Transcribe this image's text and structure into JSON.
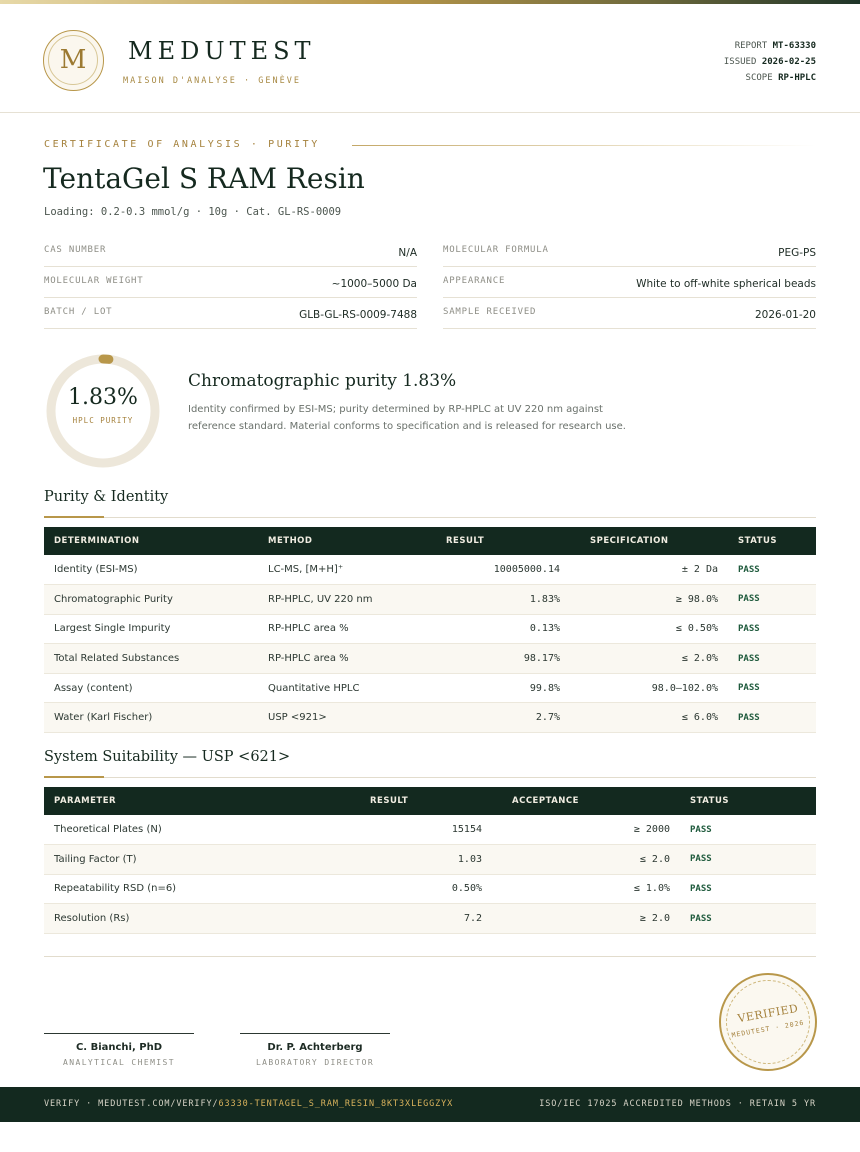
{
  "brand": {
    "logo_letter": "M",
    "name": "MEDUTEST",
    "tagline": "MAISON D'ANALYSE · GENÈVE"
  },
  "report_meta": [
    {
      "label": "REPORT",
      "value": "MT-63330"
    },
    {
      "label": "ISSUED",
      "value": "2026-02-25"
    },
    {
      "label": "SCOPE",
      "value": "RP-HPLC"
    }
  ],
  "document": {
    "eyebrow": "CERTIFICATE OF ANALYSIS · PURITY",
    "title": "TentaGel S RAM Resin",
    "subtitle": "Loading: 0.2-0.3 mmol/g · 10g  ·  Cat. GL-RS-0009"
  },
  "specs_left": [
    {
      "key": "CAS NUMBER",
      "value": "N/A"
    },
    {
      "key": "MOLECULAR WEIGHT",
      "value": "~1000–5000 Da"
    },
    {
      "key": "BATCH / LOT",
      "value": "GLB-GL-RS-0009-7488"
    }
  ],
  "specs_right": [
    {
      "key": "MOLECULAR FORMULA",
      "value": "PEG-PS"
    },
    {
      "key": "APPEARANCE",
      "value": "White to off-white spherical beads"
    },
    {
      "key": "SAMPLE RECEIVED",
      "value": "2026-01-20"
    }
  ],
  "purity": {
    "value_text": "1.83%",
    "value_fraction": 0.0183,
    "label": "HPLC PURITY",
    "heading": "Chromatographic purity 1.83%",
    "text": "Identity confirmed by ESI-MS; purity determined by RP-HPLC at UV 220 nm against reference standard. Material conforms to specification and is released for research use."
  },
  "purity_section": {
    "title": "Purity & Identity",
    "headers": [
      "DETERMINATION",
      "METHOD",
      "RESULT",
      "SPECIFICATION",
      "STATUS"
    ],
    "rows": [
      {
        "determination": "Identity (ESI-MS)",
        "method": "LC-MS, [M+H]⁺",
        "result": "10005000.14",
        "spec": "± 2 Da",
        "status": "PASS"
      },
      {
        "determination": "Chromatographic Purity",
        "method": "RP-HPLC, UV 220 nm",
        "result": "1.83%",
        "spec": "≥ 98.0%",
        "status": "PASS"
      },
      {
        "determination": "Largest Single Impurity",
        "method": "RP-HPLC area %",
        "result": "0.13%",
        "spec": "≤ 0.50%",
        "status": "PASS"
      },
      {
        "determination": "Total Related Substances",
        "method": "RP-HPLC area %",
        "result": "98.17%",
        "spec": "≤ 2.0%",
        "status": "PASS"
      },
      {
        "determination": "Assay (content)",
        "method": "Quantitative HPLC",
        "result": "99.8%",
        "spec": "98.0–102.0%",
        "status": "PASS"
      },
      {
        "determination": "Water (Karl Fischer)",
        "method": "USP <921>",
        "result": "2.7%",
        "spec": "≤ 6.0%",
        "status": "PASS"
      }
    ]
  },
  "suitability_section": {
    "title": "System Suitability — USP <621>",
    "headers": [
      "PARAMETER",
      "RESULT",
      "ACCEPTANCE",
      "STATUS"
    ],
    "rows": [
      {
        "parameter": "Theoretical Plates (N)",
        "result": "15154",
        "acceptance": "≥ 2000",
        "status": "PASS"
      },
      {
        "parameter": "Tailing Factor (T)",
        "result": "1.03",
        "acceptance": "≤ 2.0",
        "status": "PASS"
      },
      {
        "parameter": "Repeatability RSD (n=6)",
        "result": "0.50%",
        "acceptance": "≤ 1.0%",
        "status": "PASS"
      },
      {
        "parameter": "Resolution (Rs)",
        "result": "7.2",
        "acceptance": "≥ 2.0",
        "status": "PASS"
      }
    ]
  },
  "signatures": [
    {
      "name": "C. Bianchi, PhD",
      "role": "ANALYTICAL CHEMIST"
    },
    {
      "name": "Dr. P. Achterberg",
      "role": "LABORATORY DIRECTOR"
    }
  ],
  "seal": {
    "main": "VERIFIED",
    "sub": "MEDUTEST · 2026"
  },
  "footer": {
    "verify_prefix": "VERIFY · MEDUTEST.COM/VERIFY/",
    "verify_code": "63330-TENTAGEL_S_RAM_RESIN_8KT3XLEGGZYX",
    "right": "ISO/IEC 17025 ACCREDITED METHODS · RETAIN 5 YR"
  },
  "colors": {
    "primary_dark": "#13291f",
    "gold": "#b8974a",
    "ring_track": "#ede7da",
    "pass_green": "#1e5a3c"
  }
}
